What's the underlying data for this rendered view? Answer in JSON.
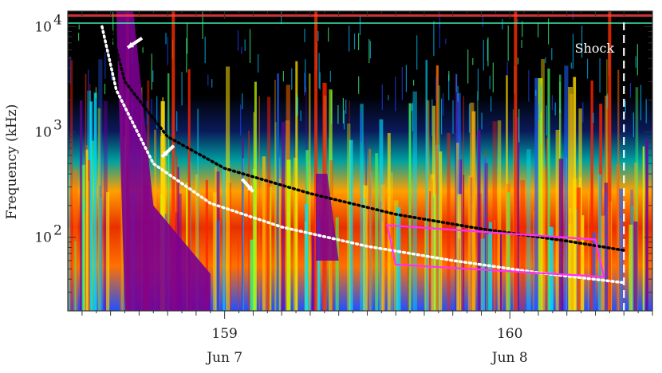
{
  "chart_data": {
    "type": "heatmap",
    "description_of_axes": {
      "x_axis": "time (day of year)",
      "y_axis": "frequency, log scale"
    },
    "ylabel": "Frequency (kHz)",
    "yscale": "log",
    "ylim_khz": [
      20,
      14000
    ],
    "y_ticks": [
      {
        "value": 100,
        "label": "10",
        "exp": "2"
      },
      {
        "value": 1000,
        "label": "10",
        "exp": "3"
      },
      {
        "value": 10000,
        "label": "10",
        "exp": "4"
      }
    ],
    "xlim_doy": [
      158.45,
      160.5
    ],
    "x_ticks": [
      {
        "value": 159,
        "label": "159",
        "date": "Jun 7"
      },
      {
        "value": 160,
        "label": "160",
        "date": "Jun 8"
      }
    ],
    "annotations": [
      {
        "text": "Shock",
        "x_doy": 160.25,
        "y_khz": 7000
      }
    ],
    "overlays": {
      "black_dotted_curve": [
        [
          158.6,
          10000
        ],
        [
          158.65,
          3000
        ],
        [
          158.8,
          900
        ],
        [
          159.0,
          450
        ],
        [
          159.3,
          260
        ],
        [
          159.6,
          165
        ],
        [
          159.9,
          120
        ],
        [
          160.2,
          92
        ],
        [
          160.4,
          75
        ]
      ],
      "white_dotted_curve": [
        [
          158.57,
          10000
        ],
        [
          158.62,
          2500
        ],
        [
          158.75,
          500
        ],
        [
          158.95,
          210
        ],
        [
          159.2,
          125
        ],
        [
          159.5,
          82
        ],
        [
          159.8,
          60
        ],
        [
          160.1,
          46
        ],
        [
          160.4,
          37
        ]
      ],
      "magenta_quadrilateral": [
        [
          159.57,
          130
        ],
        [
          160.3,
          95
        ],
        [
          160.33,
          42
        ],
        [
          159.6,
          55
        ]
      ],
      "shock_line_x_doy": 160.4,
      "white_arrows": [
        {
          "tip_doy": 158.66,
          "tip_khz": 6300
        },
        {
          "tip_doy": 158.78,
          "tip_khz": 580
        },
        {
          "tip_doy": 159.1,
          "tip_khz": 270
        }
      ]
    }
  }
}
